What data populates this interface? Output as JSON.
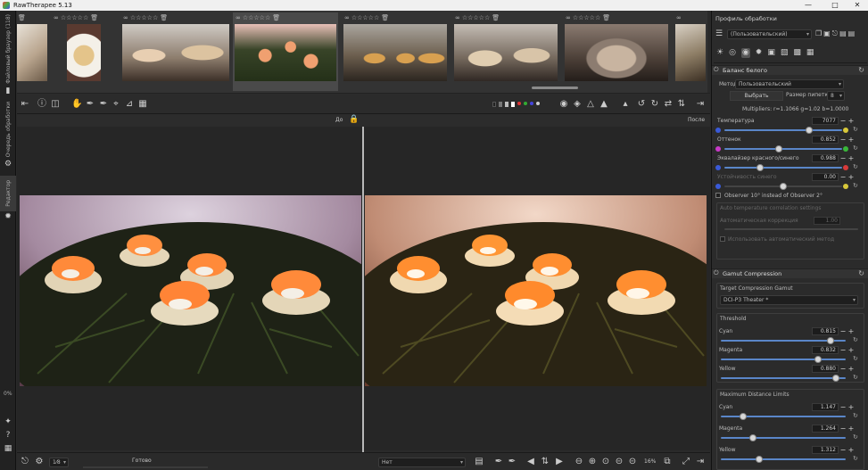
{
  "window": {
    "title": "RawTherapee 5.13"
  },
  "left_tabs": {
    "file_browser": "Файловый браузер (118)",
    "queue": "Очередь обработки",
    "editor": "Редактор"
  },
  "left_percent": "0%",
  "filmstrip": {
    "rating_stars": "☆☆☆☆☆"
  },
  "toolbar": {
    "before_label": "До",
    "after_label": "После"
  },
  "bottom": {
    "status": "Готово",
    "profile_combo": "Нет",
    "zoom": "16%",
    "sample_combo": "1⁄8"
  },
  "panel": {
    "header": "Профиль обработки",
    "profile_value": "(Пользовательский)",
    "colors": {
      "accent": "#5a86c8",
      "red": "#d83a3a",
      "green": "#3ab83a",
      "blue": "#3a5ad8",
      "yellow": "#d8c83a",
      "magenta": "#c83ac8"
    },
    "white_balance": {
      "title": "Баланс белого",
      "method_label": "Метод:",
      "method_value": "Пользовательский",
      "pick_button": "Выбрать",
      "pipette_label": "Размер пипетки:",
      "pipette_value": "8",
      "multipliers": "Multipliers: r=1.1066 g=1.02 b=1.0000",
      "rows": [
        {
          "label": "Температура",
          "value": "7077",
          "pos": 0.72
        },
        {
          "label": "Оттенок",
          "value": "0.852",
          "pos": 0.46
        },
        {
          "label": "Эквалайзер красного/синего",
          "value": "0.988",
          "pos": 0.3
        },
        {
          "label": "Устойчивость синего",
          "value": "0.00",
          "pos": 0.5
        }
      ],
      "observer_label": "Observer 10° instead of Observer 2°",
      "auto_label": "Auto temperature correlation settings",
      "auto_row_label": "Автоматическая коррекция",
      "auto_row_value": "1.00",
      "auto_chk_label": "Использовать автоматический метод"
    },
    "gamut": {
      "title": "Gamut Compression",
      "target_label": "Target Compression Gamut",
      "target_value": "DCI-P3 Theater *",
      "threshold_label": "Threshold",
      "threshold": [
        {
          "label": "Cyan",
          "value": "0.815",
          "pos": 0.88
        },
        {
          "label": "Magenta",
          "value": "0.832",
          "pos": 0.78
        },
        {
          "label": "Yellow",
          "value": "0.880",
          "pos": 0.92
        }
      ],
      "distance_label": "Maximum Distance Limits",
      "distance": [
        {
          "label": "Cyan",
          "value": "1.147",
          "pos": 0.18
        },
        {
          "label": "Magenta",
          "value": "1.264",
          "pos": 0.26
        },
        {
          "label": "Yellow",
          "value": "1.312",
          "pos": 0.31
        }
      ]
    }
  }
}
